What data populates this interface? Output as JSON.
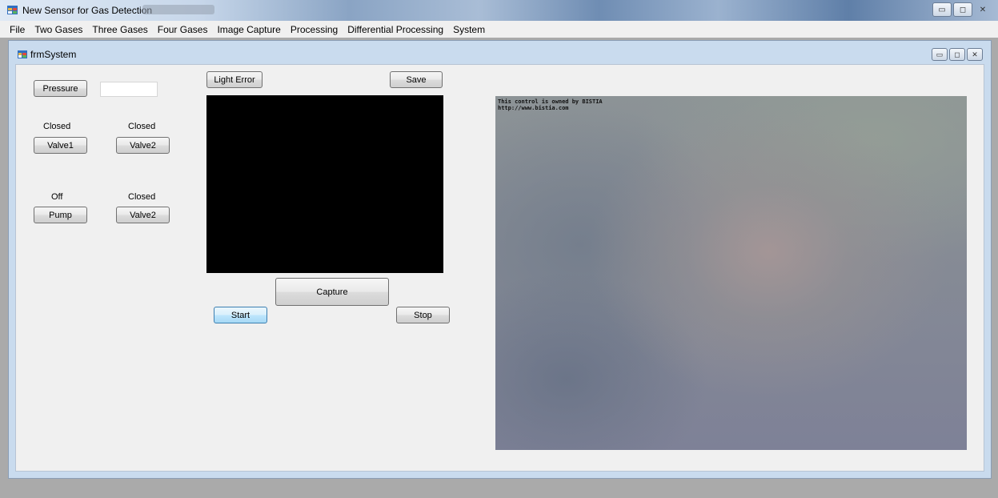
{
  "window": {
    "title": "New Sensor for Gas Detection",
    "controls": {
      "minimize": "▭",
      "maximize": "◻",
      "close": "✕"
    }
  },
  "menu": [
    "File",
    "Two Gases",
    "Three Gases",
    "Four Gases",
    "Image Capture",
    "Processing",
    "Differential Processing",
    "System"
  ],
  "child": {
    "title": "frmSystem",
    "controls": {
      "minimize": "▭",
      "maximize": "◻",
      "close": "✕"
    }
  },
  "controls": {
    "pressure_button": "Pressure",
    "pressure_value": "",
    "valve1_status": "Closed",
    "valve1_button": "Valve1",
    "valve2_status": "Closed",
    "valve2_button": "Valve2",
    "pump_status": "Off",
    "pump_button": "Pump",
    "valve2b_status": "Closed",
    "valve2b_button": "Valve2",
    "light_error_button": "Light Error",
    "save_button": "Save",
    "capture_button": "Capture",
    "start_button": "Start",
    "stop_button": "Stop"
  },
  "camera": {
    "watermark_line1": "This control is owned by BISTIA",
    "watermark_line2": "http://www.bistia.com"
  },
  "icons": {
    "app": "form-icon",
    "child": "form-icon"
  }
}
